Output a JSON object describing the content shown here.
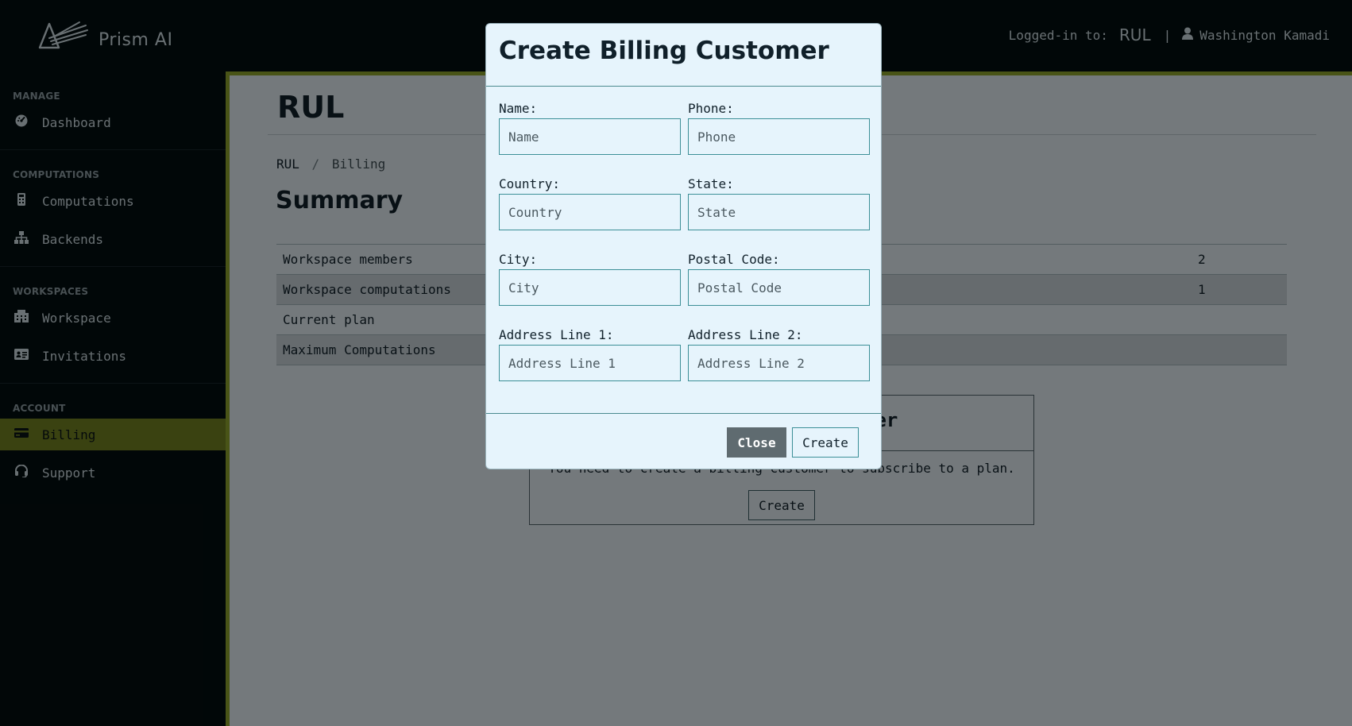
{
  "app": {
    "name": "Prism AI"
  },
  "header": {
    "logged_in_label": "Logged-in to:",
    "workspace": "RUL",
    "separator": "|",
    "user_name": "Washington Kamadi"
  },
  "sidebar": {
    "sections": [
      {
        "title": "MANAGE",
        "items": [
          {
            "label": "Dashboard",
            "icon": "dashboard-icon"
          }
        ]
      },
      {
        "title": "COMPUTATIONS",
        "items": [
          {
            "label": "Computations",
            "icon": "calculator-icon"
          },
          {
            "label": "Backends",
            "icon": "sitemap-icon"
          }
        ]
      },
      {
        "title": "WORKSPACES",
        "items": [
          {
            "label": "Workspace",
            "icon": "building-icon"
          },
          {
            "label": "Invitations",
            "icon": "id-card-icon"
          }
        ]
      },
      {
        "title": "ACCOUNT",
        "items": [
          {
            "label": "Billing",
            "icon": "credit-card-icon",
            "active": true
          },
          {
            "label": "Support",
            "icon": "headset-icon"
          }
        ]
      }
    ]
  },
  "main": {
    "title": "RUL",
    "breadcrumb": {
      "root": "RUL",
      "separator": "/",
      "current": "Billing"
    },
    "summary_heading": "Summary",
    "summary_rows": [
      {
        "label": "Workspace members",
        "value": "2"
      },
      {
        "label": "Workspace computations",
        "value": "1"
      },
      {
        "label": "Current plan",
        "value": ""
      },
      {
        "label": "Maximum Computations",
        "value": ""
      }
    ],
    "notice": {
      "title_visible": "mer",
      "text": "You need to create a billing customer to subscribe to a plan.",
      "button": "Create"
    }
  },
  "modal": {
    "title": "Create Billing Customer",
    "fields": [
      {
        "label": "Name:",
        "placeholder": "Name",
        "value": ""
      },
      {
        "label": "Phone:",
        "placeholder": "Phone",
        "value": ""
      },
      {
        "label": "Country:",
        "placeholder": "Country",
        "value": ""
      },
      {
        "label": "State:",
        "placeholder": "State",
        "value": ""
      },
      {
        "label": "City:",
        "placeholder": "City",
        "value": ""
      },
      {
        "label": "Postal Code:",
        "placeholder": "Postal Code",
        "value": ""
      },
      {
        "label": "Address Line 1:",
        "placeholder": "Address Line 1",
        "value": ""
      },
      {
        "label": "Address Line 2:",
        "placeholder": "Address Line 2",
        "value": ""
      }
    ],
    "close_label": "Close",
    "create_label": "Create"
  },
  "colors": {
    "sidebar_bg": "#030e10",
    "accent": "#8da12c",
    "active_item": "#6f7f22",
    "modal_bg": "#e6f4fc",
    "input_border": "#3c8f97",
    "close_button": "#5f6b70"
  }
}
